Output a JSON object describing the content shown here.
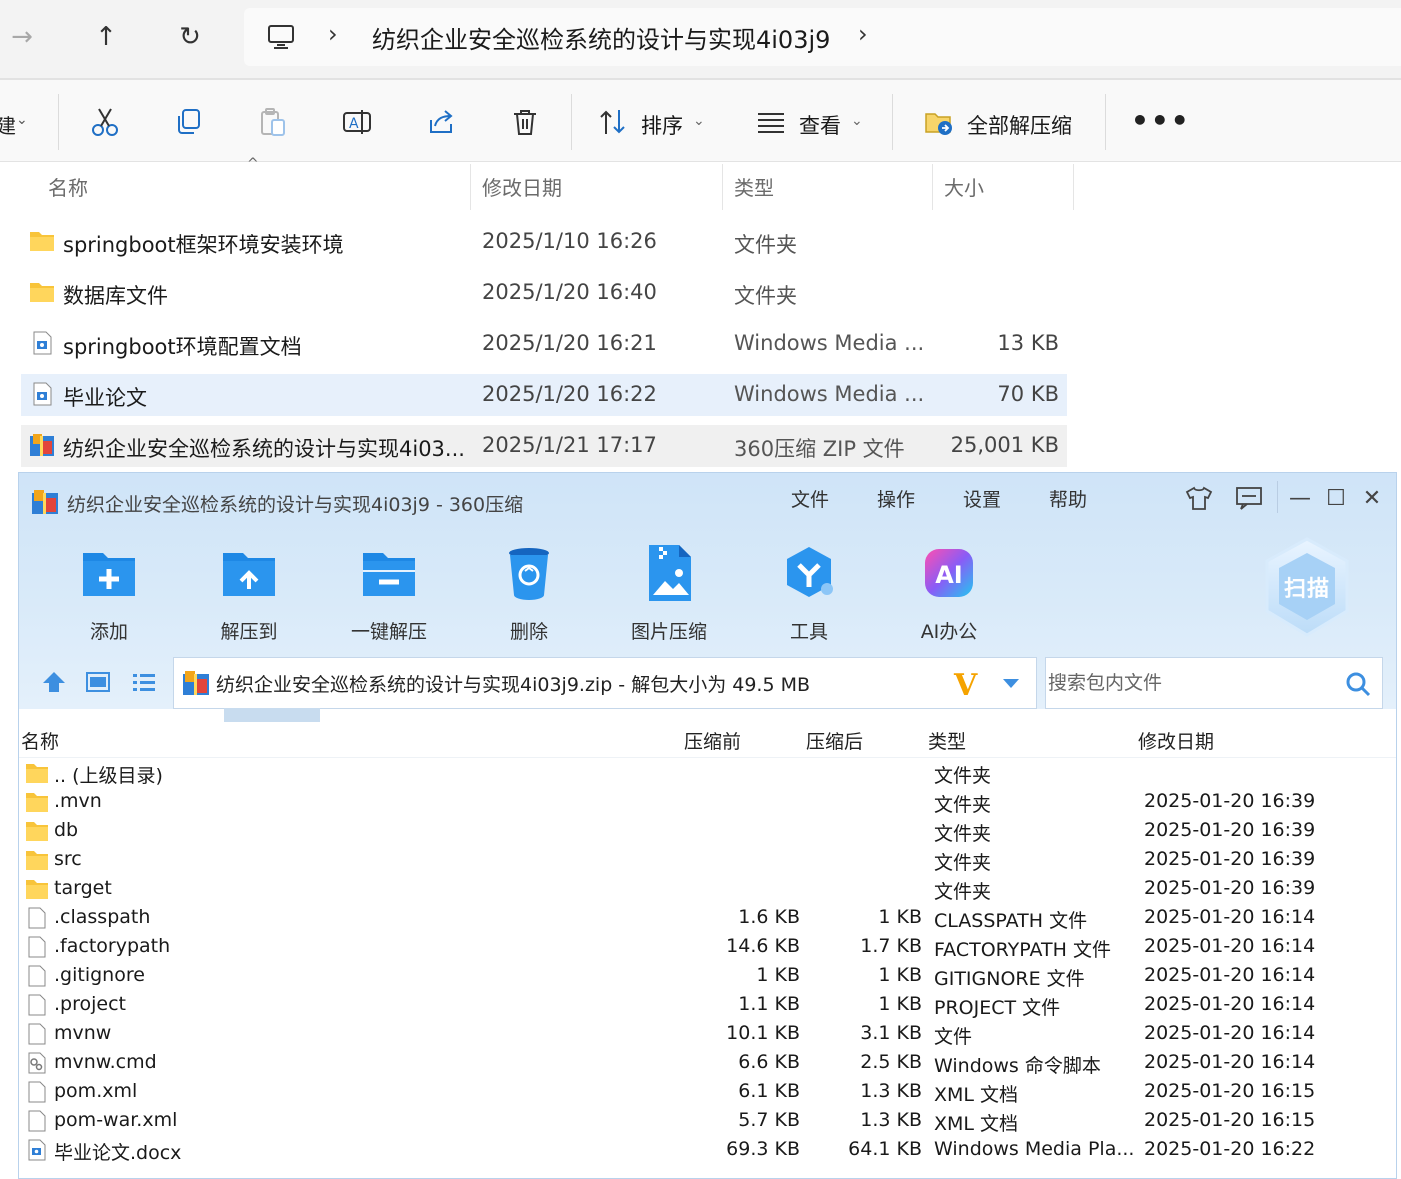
{
  "explorer": {
    "nav": {
      "forward_glyph": "→",
      "up_glyph": "↑",
      "refresh_glyph": "↻",
      "separator": "›",
      "path": "纺织企业安全巡检系统的设计与实现4i03j9"
    },
    "toolbar": {
      "new_partial": "建",
      "sort_label": "排序",
      "view_label": "查看",
      "extract_all_label": "全部解压缩",
      "more_label": "•••"
    },
    "columns": {
      "name": "名称",
      "modified": "修改日期",
      "type": "类型",
      "size": "大小"
    },
    "files": [
      {
        "name": "springboot框架环境安装环境",
        "modified": "2025/1/10 16:26",
        "type": "文件夹",
        "size": "",
        "icon": "folder-icon"
      },
      {
        "name": "数据库文件",
        "modified": "2025/1/20 16:40",
        "type": "文件夹",
        "size": "",
        "icon": "folder-icon"
      },
      {
        "name": "springboot环境配置文档",
        "modified": "2025/1/20 16:21",
        "type": "Windows Media ...",
        "size": "13 KB",
        "icon": "document-icon"
      },
      {
        "name": "毕业论文",
        "modified": "2025/1/20 16:22",
        "type": "Windows Media ...",
        "size": "70 KB",
        "icon": "document-icon"
      },
      {
        "name": "纺织企业安全巡检系统的设计与实现4i03...",
        "modified": "2025/1/21 17:17",
        "type": "360压缩 ZIP 文件",
        "size": "25,001 KB",
        "icon": "zip-archive-icon"
      }
    ]
  },
  "archiver": {
    "title": "纺织企业安全巡检系统的设计与实现4i03j9 - 360压缩",
    "menu": [
      "文件",
      "操作",
      "设置",
      "帮助"
    ],
    "window_controls": {
      "minimize": "—",
      "maximize": "☐",
      "close": "✕"
    },
    "tools": [
      {
        "label": "添加",
        "icon": "add-icon"
      },
      {
        "label": "解压到",
        "icon": "extract-to-icon"
      },
      {
        "label": "一键解压",
        "icon": "one-click-extract-icon"
      },
      {
        "label": "删除",
        "icon": "delete-icon"
      },
      {
        "label": "图片压缩",
        "icon": "image-compress-icon"
      },
      {
        "label": "工具",
        "icon": "tools-icon"
      },
      {
        "label": "AI办公",
        "icon": "ai-office-icon"
      }
    ],
    "scan_label": "扫描",
    "ai_badge": "AI",
    "path_text": "纺织企业安全巡检系统的设计与实现4i03j9.zip - 解包大小为 49.5 MB",
    "vip_logo": "V",
    "search_placeholder": "搜索包内文件",
    "columns": {
      "name": "名称",
      "before": "压缩前",
      "after": "压缩后",
      "type": "类型",
      "modified": "修改日期"
    },
    "entries": [
      {
        "name": ".. (上级目录)",
        "before": "",
        "after": "",
        "type": "文件夹",
        "modified": "",
        "icon": "folder-icon"
      },
      {
        "name": ".mvn",
        "before": "",
        "after": "",
        "type": "文件夹",
        "modified": "2025-01-20 16:39",
        "icon": "folder-icon"
      },
      {
        "name": "db",
        "before": "",
        "after": "",
        "type": "文件夹",
        "modified": "2025-01-20 16:39",
        "icon": "folder-icon"
      },
      {
        "name": "src",
        "before": "",
        "after": "",
        "type": "文件夹",
        "modified": "2025-01-20 16:39",
        "icon": "folder-icon"
      },
      {
        "name": "target",
        "before": "",
        "after": "",
        "type": "文件夹",
        "modified": "2025-01-20 16:39",
        "icon": "folder-icon"
      },
      {
        "name": ".classpath",
        "before": "1.6 KB",
        "after": "1 KB",
        "type": "CLASSPATH 文件",
        "modified": "2025-01-20 16:14",
        "icon": "file-icon"
      },
      {
        "name": ".factorypath",
        "before": "14.6 KB",
        "after": "1.7 KB",
        "type": "FACTORYPATH 文件",
        "modified": "2025-01-20 16:14",
        "icon": "file-icon"
      },
      {
        "name": ".gitignore",
        "before": "1 KB",
        "after": "1 KB",
        "type": "GITIGNORE 文件",
        "modified": "2025-01-20 16:14",
        "icon": "file-icon"
      },
      {
        "name": ".project",
        "before": "1.1 KB",
        "after": "1 KB",
        "type": "PROJECT 文件",
        "modified": "2025-01-20 16:14",
        "icon": "file-icon"
      },
      {
        "name": "mvnw",
        "before": "10.1 KB",
        "after": "3.1 KB",
        "type": "文件",
        "modified": "2025-01-20 16:14",
        "icon": "file-icon"
      },
      {
        "name": "mvnw.cmd",
        "before": "6.6 KB",
        "after": "2.5 KB",
        "type": "Windows 命令脚本",
        "modified": "2025-01-20 16:14",
        "icon": "script-icon"
      },
      {
        "name": "pom.xml",
        "before": "6.1 KB",
        "after": "1.3 KB",
        "type": "XML 文档",
        "modified": "2025-01-20 16:15",
        "icon": "file-icon"
      },
      {
        "name": "pom-war.xml",
        "before": "5.7 KB",
        "after": "1.3 KB",
        "type": "XML 文档",
        "modified": "2025-01-20 16:15",
        "icon": "file-icon"
      },
      {
        "name": "毕业论文.docx",
        "before": "69.3 KB",
        "after": "64.1 KB",
        "type": "Windows Media Pla...",
        "modified": "2025-01-20 16:22",
        "icon": "document-icon"
      }
    ]
  }
}
